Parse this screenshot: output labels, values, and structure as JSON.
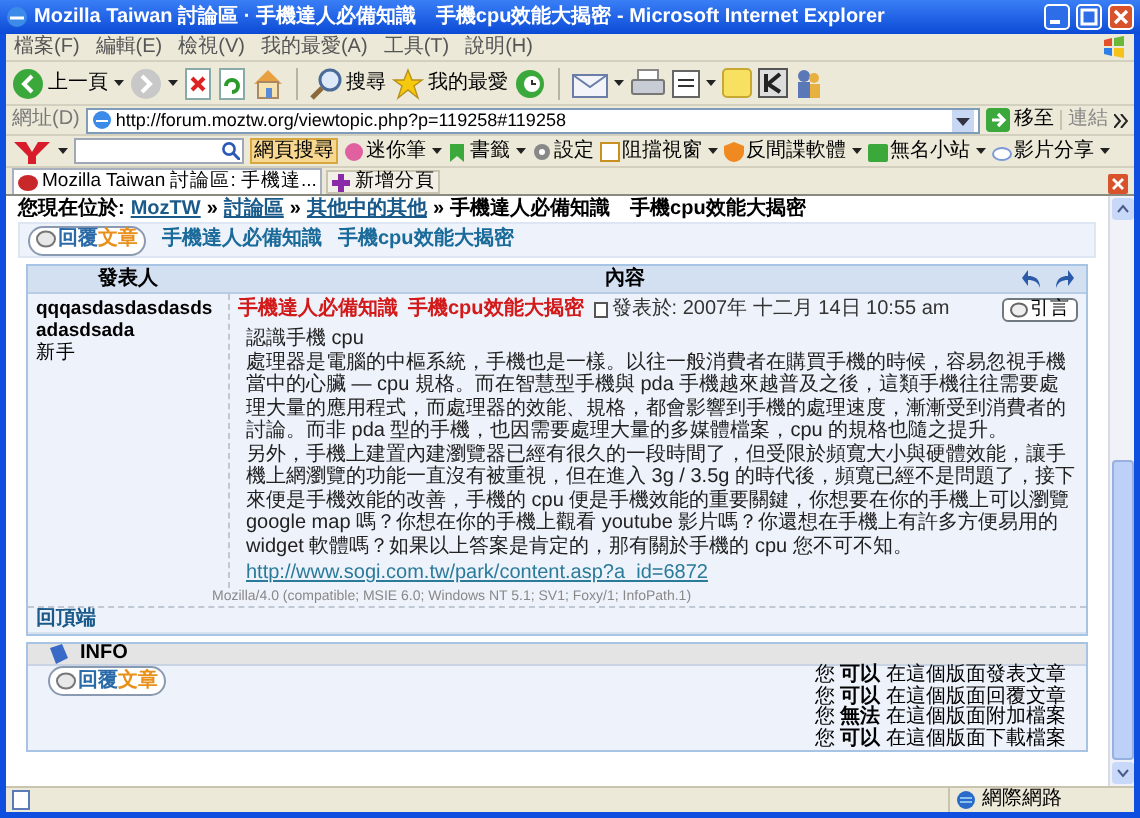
{
  "window": {
    "title": "Mozilla Taiwan 討論區 · 手機達人必備知識　手機cpu效能大揭密 - Microsoft Internet Explorer"
  },
  "menu_bar": [
    "檔案(F)",
    "編輯(E)",
    "檢視(V)",
    "我的最愛(A)",
    "工具(T)",
    "說明(H)"
  ],
  "toolbar": {
    "back": "上一頁",
    "search": "搜尋",
    "favorites": "我的最愛"
  },
  "address_bar": {
    "label": "網址(D)",
    "url": "http://forum.moztw.org/viewtopic.php?p=119258#119258",
    "go": "移至",
    "links": "連結"
  },
  "yahoo_toolbar": {
    "search_button": "網頁搜尋",
    "items": [
      "迷你筆",
      "書籤",
      "設定",
      "阻擋視窗",
      "反間諜軟體",
      "無名小站",
      "影片分享"
    ]
  },
  "tabs": [
    {
      "label": "Mozilla Taiwan 討論區: 手機達...",
      "selected": true
    }
  ],
  "new_tab": "新增分頁",
  "breadcrumb": {
    "label": "您現在位於:",
    "separator": "»",
    "links": [
      "MozTW",
      "討論區",
      "其他中的其他"
    ],
    "current": "手機達人必備知識　手機cpu效能大揭密"
  },
  "topic_bar": {
    "reply_button": {
      "part_1": "回覆",
      "part_2": "文章"
    },
    "links": [
      "手機達人必備知識",
      "手機cpu效能大揭密"
    ]
  },
  "post_table": {
    "columns": [
      "發表人",
      "內容"
    ],
    "post": {
      "author": "qqqasdasdasdasdsadasdsada",
      "rank": "新手",
      "title_links": [
        "手機達人必備知識",
        "手機cpu效能大揭密"
      ],
      "posted": "發表於: 2007年 十二月 14日 10:55 am",
      "quote_button": "引言",
      "body": [
        "認識手機 cpu",
        "處理器是電腦的中樞系統，手機也是一樣。以往一般消費者在購買手機的時候，容易忽視手機當中的心臟 — cpu 規格。而在智慧型手機與 pda 手機越來越普及之後，這類手機往往需要處理大量的應用程式，而處理器的效能、規格，都會影響到手機的處理速度，漸漸受到消費者的討論。而非 pda 型的手機，也因需要處理大量的多媒體檔案，cpu 的規格也隨之提升。",
        "另外，手機上建置內建瀏覽器已經有很久的一段時間了，但受限於頻寬大小與硬體效能，讓手機上網瀏覽的功能一直沒有被重視，但在進入 3g / 3.5g 的時代後，頻寬已經不是問題了，接下來便是手機效能的改善，手機的 cpu 便是手機效能的重要關鍵，你想要在你的手機上可以瀏覽 google map 嗎？你想在你的手機上觀看 youtube 影片嗎？你還想在手機上有許多方便易用的 widget 軟體嗎？如果以上答案是肯定的，那有關於手機的 cpu 您不可不知。"
      ],
      "link": "http://www.sogi.com.tw/park/content.asp?a_id=6872",
      "user_agent": "Mozilla/4.0 (compatible; MSIE 6.0; Windows NT 5.1; SV1; Foxy/1; InfoPath.1)"
    },
    "back_to_top": "回頂端"
  },
  "info_panel": {
    "title": "INFO",
    "reply_button": {
      "part_1": "回覆",
      "part_2": "文章"
    },
    "permissions": [
      "您 **可以** 在這個版面發表文章",
      "您 **可以** 在這個版面回覆文章",
      "您 **無法** 在這個版面附加檔案",
      "您 **可以** 在這個版面下載檔案"
    ]
  },
  "status_bar": {
    "zone": "網際網路"
  }
}
